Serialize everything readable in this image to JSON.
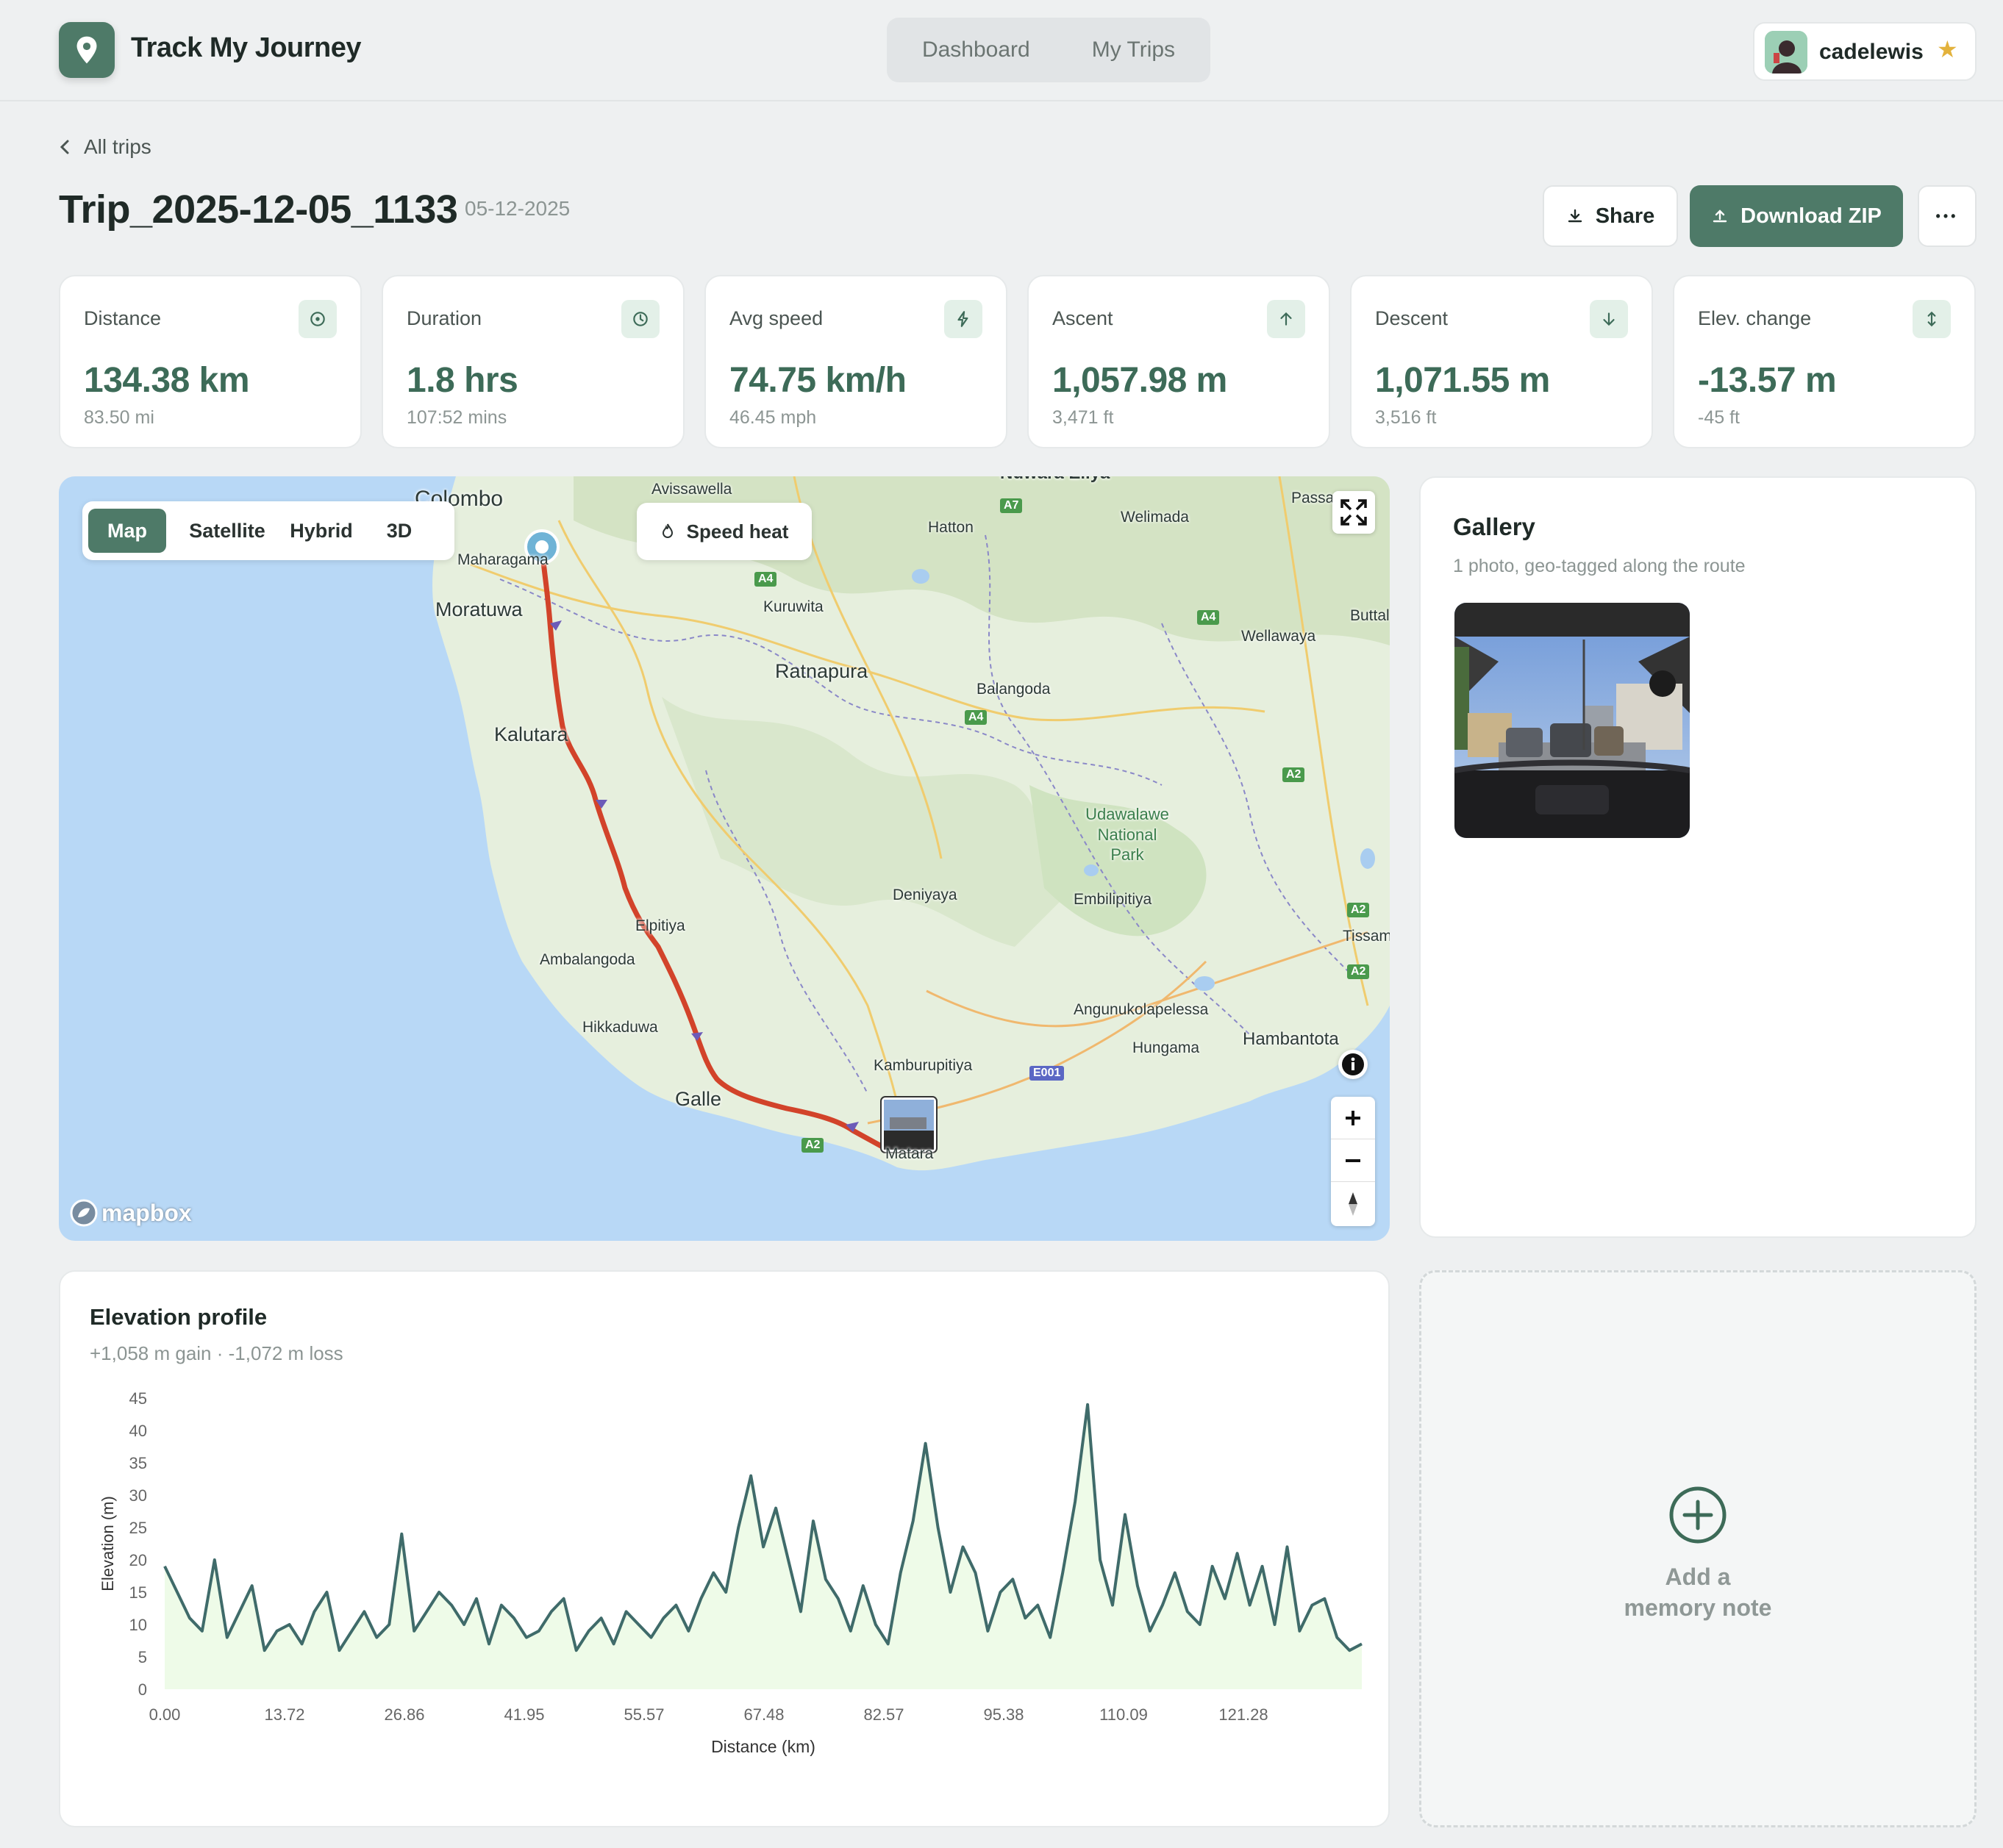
{
  "header": {
    "brand": "Track My Journey",
    "nav": [
      "Dashboard",
      "My Trips"
    ],
    "username": "cadelewis"
  },
  "trip": {
    "back_label": "All trips",
    "title": "Trip_2025-12-05_1133",
    "date": "05-12-2025",
    "share_label": "Share",
    "download_label": "Download ZIP",
    "more_label": "•••"
  },
  "stats": [
    {
      "label": "Distance",
      "value": "134.38 km",
      "sub": "83.50 mi",
      "icon": "target-icon"
    },
    {
      "label": "Duration",
      "value": "1.8 hrs",
      "sub": "107:52 mins",
      "icon": "clock-icon"
    },
    {
      "label": "Avg speed",
      "value": "74.75 km/h",
      "sub": "46.45 mph",
      "icon": "bolt-icon"
    },
    {
      "label": "Ascent",
      "value": "1,057.98 m",
      "sub": "3,471 ft",
      "icon": "arrow-up-icon"
    },
    {
      "label": "Descent",
      "value": "1,071.55 m",
      "sub": "3,516 ft",
      "icon": "arrow-down-icon"
    },
    {
      "label": "Elev. change",
      "value": "-13.57 m",
      "sub": "-45 ft",
      "icon": "arrows-vertical-icon"
    }
  ],
  "map": {
    "modes": [
      "Map",
      "Satellite",
      "Hybrid",
      "3D"
    ],
    "active_mode": "Map",
    "speed_heat_label": "Speed heat",
    "attribution": "mapbox",
    "places": [
      "Colombo",
      "Maharagama",
      "Moratuwa",
      "Avissawella",
      "Kuruwita",
      "Ratnapura",
      "Hatton",
      "Welimada",
      "Nuwara Eliya",
      "Passara",
      "Wellawaya",
      "Buttala",
      "Balangoda",
      "Kalutara",
      "Udawalawe National Park",
      "Deniyaya",
      "Embilipitiya",
      "Elpitiya",
      "Ambalangoda",
      "Hikkaduwa",
      "Galle",
      "Kamburupitiya",
      "Matara",
      "Angunukolapelessa",
      "Hungama",
      "Hambantota",
      "Tissamaharama"
    ],
    "roads": [
      "A7",
      "A4",
      "A4",
      "A4",
      "A2",
      "A2",
      "A2",
      "A2",
      "E001"
    ]
  },
  "gallery": {
    "title": "Gallery",
    "subtitle": "1 photo, geo-tagged along the route"
  },
  "elevation": {
    "title": "Elevation profile",
    "subtitle": "+1,058 m gain · -1,072 m loss"
  },
  "memory": {
    "label_line1": "Add a",
    "label_line2": "memory note"
  },
  "chart_data": {
    "type": "area",
    "xlabel": "Distance (km)",
    "ylabel": "Elevation (m)",
    "ylim": [
      0,
      45
    ],
    "y_ticks": [
      0,
      5,
      10,
      15,
      20,
      25,
      30,
      35,
      40,
      45
    ],
    "x_tick_labels": [
      "0.00",
      "13.72",
      "26.86",
      "41.95",
      "55.57",
      "67.48",
      "82.57",
      "95.38",
      "110.09",
      "121.28"
    ],
    "xlim": [
      0,
      134.38
    ],
    "x": [
      0,
      1.4,
      2.8,
      4.2,
      5.6,
      7.0,
      8.4,
      9.8,
      11.2,
      12.6,
      14.0,
      15.4,
      16.8,
      18.2,
      19.6,
      21.0,
      22.4,
      23.8,
      25.2,
      26.6,
      28.0,
      29.4,
      30.8,
      32.2,
      33.6,
      35.0,
      36.4,
      37.8,
      39.2,
      40.6,
      42.0,
      43.4,
      44.8,
      46.2,
      47.6,
      49.0,
      50.4,
      51.8,
      53.2,
      54.6,
      56.0,
      57.4,
      58.8,
      60.2,
      61.6,
      63.0,
      64.4,
      65.8,
      67.2,
      68.6,
      70.0,
      71.4,
      72.8,
      74.2,
      75.6,
      77.0,
      78.4,
      79.8,
      81.2,
      82.6,
      84.0,
      85.4,
      86.8,
      88.2,
      89.6,
      91.0,
      92.4,
      93.8,
      95.2,
      96.6,
      98.0,
      99.4,
      100.8,
      102.2,
      103.6,
      105.0,
      106.4,
      107.8,
      109.2,
      110.6,
      112.0,
      113.4,
      114.8,
      116.2,
      117.6,
      119.0,
      120.4,
      121.8,
      123.2,
      124.6,
      126.0,
      127.4,
      128.8,
      130.2,
      131.6,
      133.0,
      134.38
    ],
    "y": [
      19,
      15,
      11,
      9,
      20,
      8,
      12,
      16,
      6,
      9,
      10,
      7,
      12,
      15,
      6,
      9,
      12,
      8,
      10,
      24,
      9,
      12,
      15,
      13,
      10,
      14,
      7,
      13,
      11,
      8,
      9,
      12,
      14,
      6,
      9,
      11,
      7,
      12,
      10,
      8,
      11,
      13,
      9,
      14,
      18,
      15,
      25,
      33,
      22,
      28,
      20,
      12,
      26,
      17,
      14,
      9,
      16,
      10,
      7,
      18,
      26,
      38,
      25,
      15,
      22,
      18,
      9,
      15,
      17,
      11,
      13,
      8,
      18,
      29,
      44,
      20,
      13,
      27,
      16,
      9,
      13,
      18,
      12,
      10,
      19,
      14,
      21,
      13,
      19,
      10,
      22,
      9,
      13,
      14,
      8,
      6,
      7
    ]
  }
}
